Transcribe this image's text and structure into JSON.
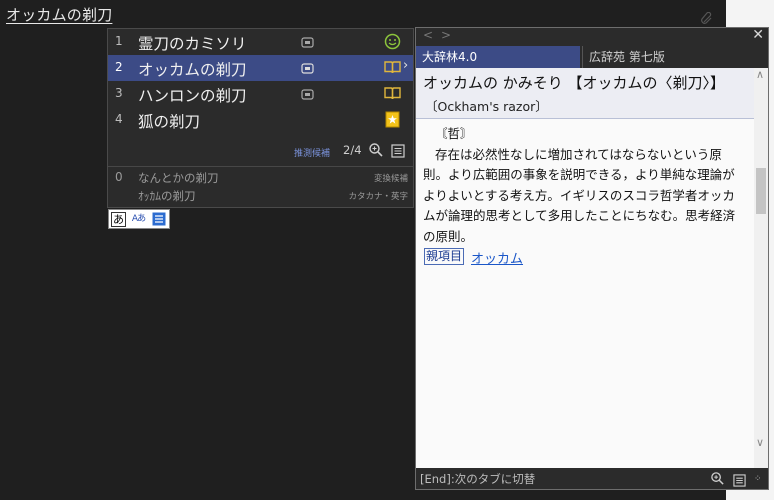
{
  "compose": {
    "text": "オッカムの剃刀"
  },
  "candidates": {
    "items": [
      {
        "num": "1",
        "text": "霊刀のカミソリ",
        "icon": "smiley-icon"
      },
      {
        "num": "2",
        "text": "オッカムの剃刀",
        "icon": "book-icon",
        "arrow": "›"
      },
      {
        "num": "3",
        "text": "ハンロンの剃刀",
        "icon": "book-icon"
      },
      {
        "num": "4",
        "text": "狐の剃刀",
        "icon": "star-icon"
      }
    ],
    "predict_label": "推測候補",
    "page": "2/4",
    "conversions": [
      {
        "num": "0",
        "text": "なんとかの剃刀",
        "tag": "変換候補"
      },
      {
        "num": "",
        "text": "ｵｯｶﾑの剃刀",
        "tag": "カタカナ・英字"
      }
    ]
  },
  "mode_bar": {
    "hiragana": "あ",
    "kana_alpha": "Aあ"
  },
  "dictionary": {
    "nav_back": "<",
    "nav_forward": ">",
    "close": "✕",
    "tabs": [
      {
        "label": "大辞林4.0"
      },
      {
        "label": "広辞苑 第七版"
      }
    ],
    "headword": "オッカムの かみそり 【オッカムの〈剃刀〉】",
    "english": "〔Ockham's razor〕",
    "field": "〘哲〙",
    "definition": "存在は必然性なしに増加されてはならないという原則。より広範囲の事象を説明できる，より単純な理論がよりよいとする考え方。イギリスのスコラ哲学者オッカムが論理的思考として多用したことにちなむ。思考経済の原則。",
    "related_badge": "親項目",
    "related_link": "オッカム",
    "footer_hint": "[End]:次のタブに切替"
  }
}
